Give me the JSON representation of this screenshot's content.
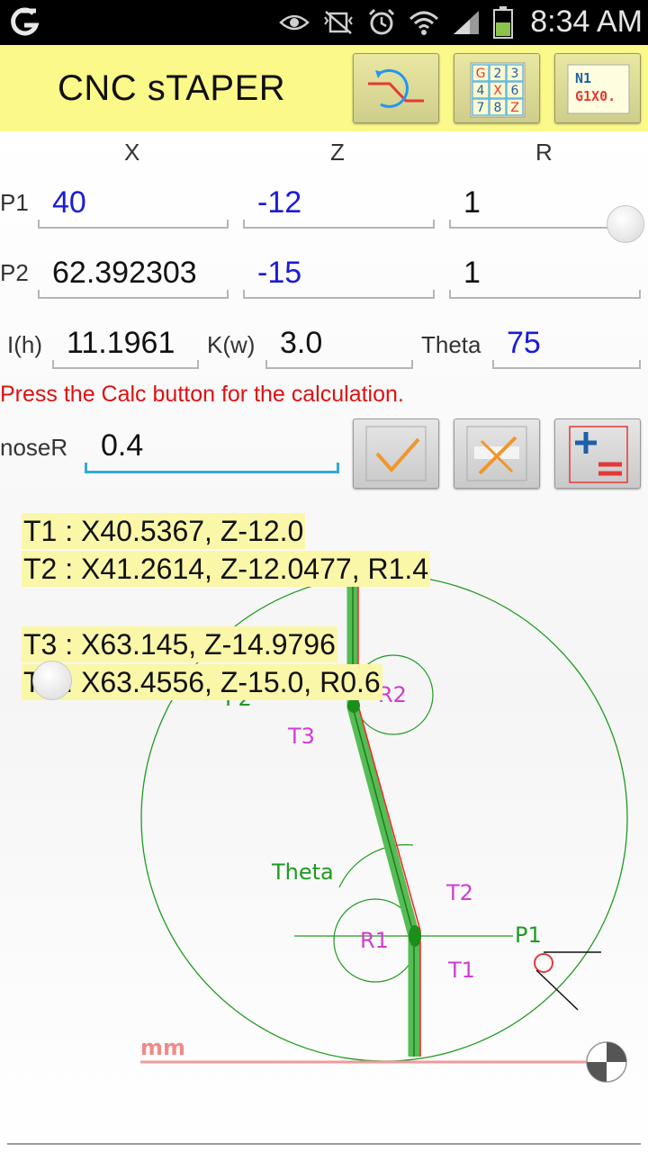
{
  "status_bar": {
    "time": "8:34 AM",
    "icons": [
      "app-logo-icon",
      "eye-icon",
      "vibrate-icon",
      "alarm-icon",
      "wifi-icon",
      "signal-icon",
      "battery-icon"
    ]
  },
  "app_bar": {
    "title": "CNC sTAPER",
    "toolbar": {
      "grid_button": {
        "cells": [
          "G",
          "2",
          "3",
          "4",
          "X",
          "6",
          "7",
          "8",
          "Z"
        ]
      },
      "nc_button": {
        "line1": "N1",
        "line2": "G1X0."
      }
    }
  },
  "inputs": {
    "columns": [
      "X",
      "Z",
      "R"
    ],
    "p1": {
      "label": "P1",
      "x": "40",
      "z": "-12",
      "r": "1"
    },
    "p2": {
      "label": "P2",
      "x": "62.392303",
      "z": "-15",
      "r": "1"
    },
    "i": {
      "label": "I(h)",
      "value": "11.1961"
    },
    "k": {
      "label": "K(w)",
      "value": "3.0"
    },
    "theta": {
      "label": "Theta",
      "value": "75"
    }
  },
  "message": "Press the Calc button for the calculation.",
  "nose": {
    "label": "noseR",
    "value": "0.4"
  },
  "results": {
    "t1": "T1 : X40.5367, Z-12.0",
    "t2": "T2 : X41.2614, Z-12.0477, R1.4",
    "t3": "T3 : X63.145, Z-14.9796",
    "t4": "T4 : X63.4556, Z-15.0, R0.6"
  },
  "drawing_labels": {
    "p1": "P1",
    "p2": "P2",
    "r1": "R1",
    "r2": "R2",
    "t1": "T1",
    "t2": "T2",
    "t3": "T3",
    "theta": "Theta",
    "unit": "mm"
  },
  "colors": {
    "appbar": "#fbf98a",
    "input_blue": "#1b1bd8",
    "message_red": "#e01010",
    "focus_blue": "#33a9d8",
    "result_highlight": "#fbf7a9",
    "path_green": "#1f9a1f",
    "path_red": "#ff2020",
    "label_magenta": "#d23cd2"
  }
}
